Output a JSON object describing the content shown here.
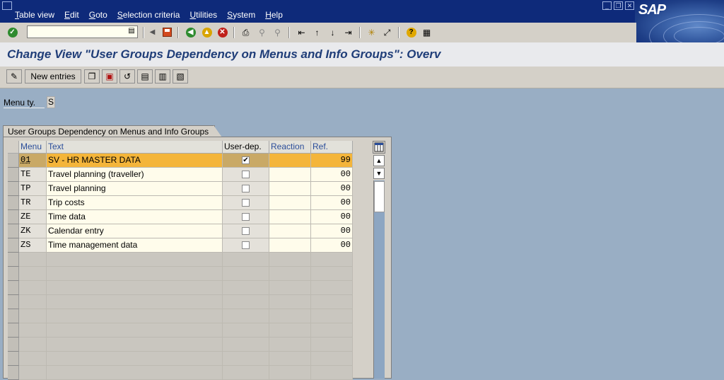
{
  "menubar": {
    "items": [
      "Table view",
      "Edit",
      "Goto",
      "Selection criteria",
      "Utilities",
      "System",
      "Help"
    ],
    "underline": [
      "T",
      "E",
      "G",
      "S",
      "U",
      "S",
      "H"
    ],
    "logo_text": "SAP"
  },
  "toolbar": {
    "command_value": "",
    "icons": [
      "enter-icon",
      "back-icon",
      "save-icon",
      "back-arrow-icon",
      "exit-icon",
      "cancel-icon",
      "print-icon",
      "find-icon",
      "find-next-icon",
      "first-page-icon",
      "previous-page-icon",
      "next-page-icon",
      "last-page-icon",
      "create-session-icon",
      "shortcut-icon",
      "help-icon",
      "layout-icon"
    ]
  },
  "title": "Change View \"User Groups Dependency on Menus and Info Groups\": Overv",
  "app_toolbar": {
    "new_entries_label": "New entries"
  },
  "field": {
    "label": "Menu ty.",
    "value": "S"
  },
  "groupbox": {
    "title": "User Groups Dependency on Menus and Info Groups"
  },
  "table": {
    "columns": [
      "Menu",
      "Text",
      "User-dep.",
      "Reaction",
      "Ref."
    ],
    "rows": [
      {
        "menu": "01",
        "text": "SV - HR MASTER DATA",
        "userdep": true,
        "reaction": "",
        "ref": "99"
      },
      {
        "menu": "TE",
        "text": "Travel planning (traveller)",
        "userdep": false,
        "reaction": "",
        "ref": "00"
      },
      {
        "menu": "TP",
        "text": "Travel planning",
        "userdep": false,
        "reaction": "",
        "ref": "00"
      },
      {
        "menu": "TR",
        "text": "Trip costs",
        "userdep": false,
        "reaction": "",
        "ref": "00"
      },
      {
        "menu": "ZE",
        "text": "Time data",
        "userdep": false,
        "reaction": "",
        "ref": "00"
      },
      {
        "menu": "ZK",
        "text": "Calendar entry",
        "userdep": false,
        "reaction": "",
        "ref": "00"
      },
      {
        "menu": "ZS",
        "text": "Time management data",
        "userdep": false,
        "reaction": "",
        "ref": "00"
      }
    ],
    "highlight_color": "#F4B53A"
  },
  "colors": {
    "menubar": "#0E2A7A",
    "title": "#1F3D78",
    "background": "#99AEC4"
  }
}
